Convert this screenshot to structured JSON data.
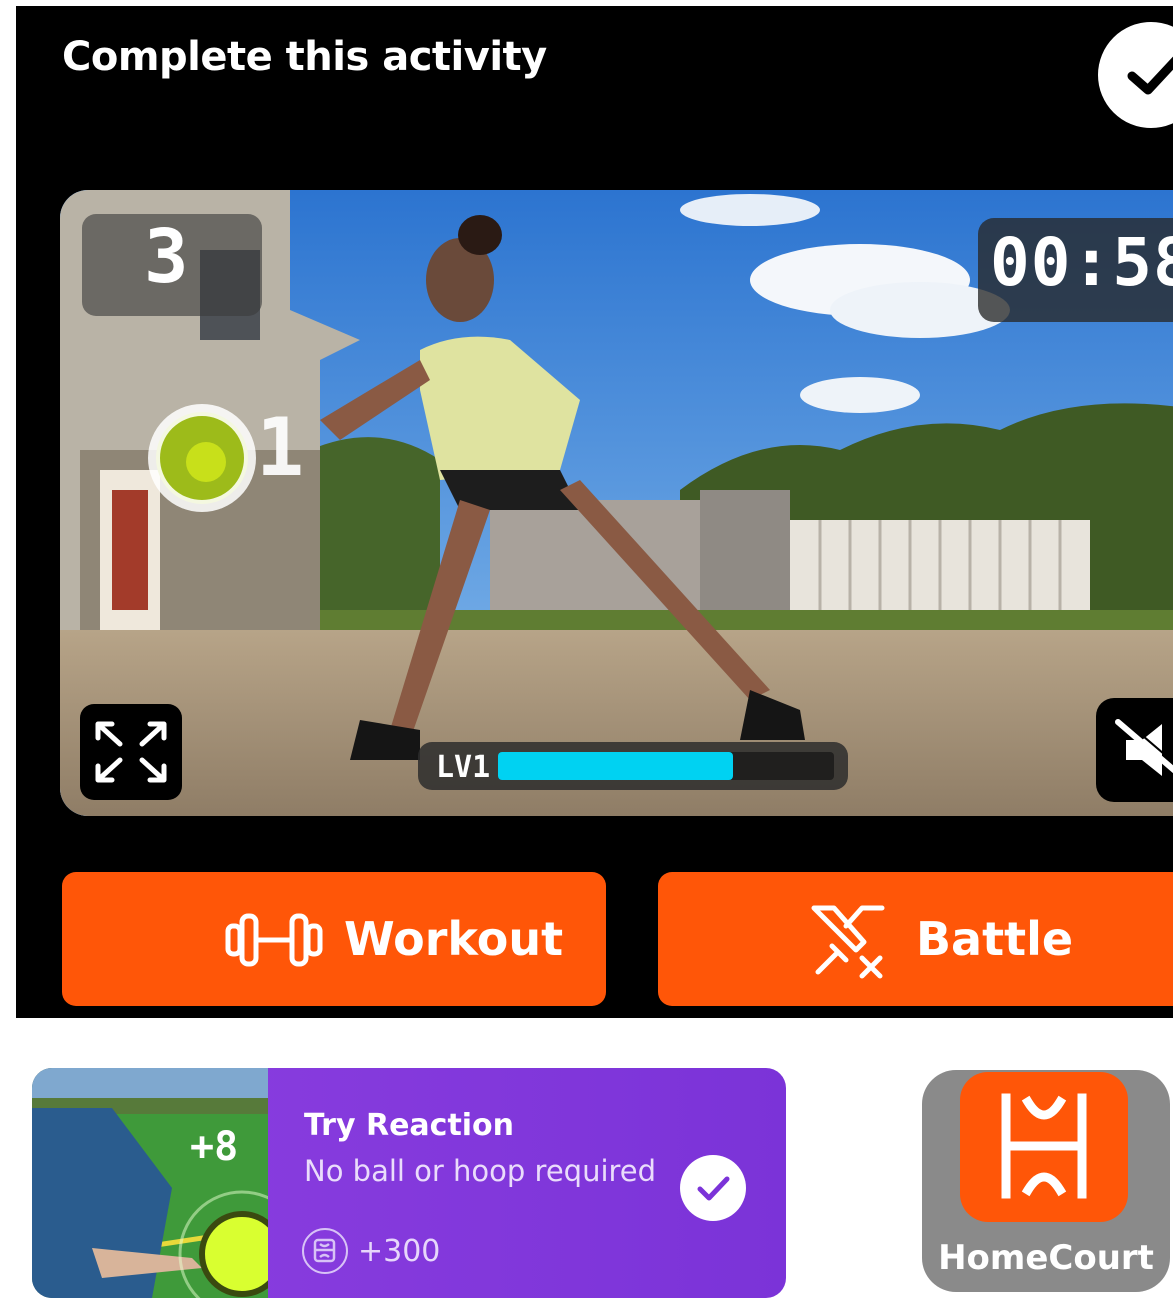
{
  "header": {
    "title": "Complete this activity",
    "check_icon": "check-icon"
  },
  "video": {
    "rep_count": "3",
    "timer": "00:58",
    "target_tail_text": "1",
    "level_label": "LV1",
    "level_progress": 0.7,
    "expand_icon": "expand-icon",
    "mute_icon": "mute-icon"
  },
  "actions": {
    "workout_label": "Workout",
    "workout_icon": "dumbbell-icon",
    "battle_label": "Battle",
    "battle_icon": "crossed-swords-icon"
  },
  "promo_card": {
    "title": "Try Reaction",
    "subtitle": "No ball or hoop required",
    "points": "+300",
    "thumb_badge": "+8",
    "points_icon": "homecourt-coin-icon",
    "check_icon": "check-icon"
  },
  "app": {
    "name": "HomeCourt",
    "icon": "homecourt-logo-icon"
  },
  "colors": {
    "accent": "#ff5608",
    "progress": "#00d2f2",
    "card": "#8c3fe0"
  }
}
